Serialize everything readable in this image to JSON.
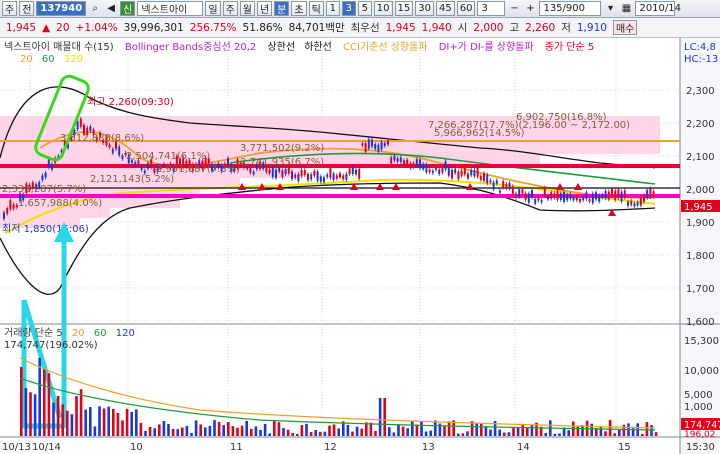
{
  "toolbar": {
    "mode_label": "주",
    "view_label": "전",
    "stock_code": "137940",
    "flag_label": "신",
    "stock_name": "넥스트아이",
    "period_buttons": [
      "일",
      "주",
      "월",
      "년",
      "분",
      "초",
      "틱"
    ],
    "interval_buttons": [
      "1",
      "3",
      "5",
      "10",
      "15",
      "30",
      "45",
      "60"
    ],
    "interval_value": "3",
    "count_value": "135/900",
    "date_value": "2010/14"
  },
  "price_strip": {
    "price": "1,945",
    "change": "20",
    "change_pct": "+1.04%",
    "volume": "39,996,301",
    "ratio1": "256.75%",
    "ratio2": "51.86%",
    "amount": "84,701백만",
    "best_ask_label": "최우선",
    "best_ask": "1,945",
    "best_bid": "1,940",
    "open_label": "시",
    "open": "2,000",
    "high_label": "고",
    "high": "2,260",
    "low_label": "저",
    "low": "1,910",
    "order_label": "매수"
  },
  "legend": {
    "title": "넥스트아이 매물대 수(15)",
    "bollinger": "Bollinger Bands중심선 20,2",
    "upper": "상한선",
    "lower": "하한선",
    "cci": "CCI기준선 상향돌파",
    "dmi": "DI+가 DI-를 상향돌파",
    "close_ma": "종가 단순 5",
    "ma_periods": [
      "20",
      "60",
      "120"
    ],
    "right_tag1": "LC:4,8",
    "right_tag2": "HC:-13"
  },
  "annotations": {
    "high_label": "최고 2,260(09:30)",
    "low_label": "최저 1,850(15:06)",
    "profile_labels": [
      "6,902,750(16.8%)",
      "7,266,287(17.7%)(2,196.00 ~ 2,172.00)",
      "5,966,962(14.5%)",
      "3,771,502(9.2%)",
      "2,504,741(6.1%)",
      "2,991,687(7.3%)",
      "2,741,935(6.7%)",
      "2,121,143(5.2%)",
      "3,512,888(8.6%)",
      "2,333,287(5.7%)",
      "1,657,988(4.0%)"
    ],
    "price_tag": "1,945",
    "volume_tag": "174,747",
    "volume_tag2": "196,02"
  },
  "price_axis": [
    "2,300",
    "2,200",
    "2,100",
    "2,000",
    "1,900",
    "1,800",
    "1,700",
    "1,600"
  ],
  "volume_axis": [
    "15,300",
    "10,000",
    "5,000",
    "1,000"
  ],
  "volume_legend": {
    "title": "거래량 단순 5",
    "periods": [
      "20",
      "60",
      "120"
    ],
    "value": "174,747(196.02%)"
  },
  "date_axis": [
    "10/13",
    "10/14",
    "10",
    "11",
    "12",
    "13",
    "14",
    "15",
    "15:30"
  ],
  "colors": {
    "up": "#e0001b",
    "down": "#1a37d8",
    "resistance_red": "#e8003c",
    "support_magenta": "#ff00c8",
    "orange_line": "#f0a030",
    "yellow_line": "#f4e000",
    "green_line": "#1f9a3a",
    "profile_fill": "#ffc4df",
    "highlight_green": "#38d81e",
    "highlight_cyan": "#29d8e8"
  }
}
